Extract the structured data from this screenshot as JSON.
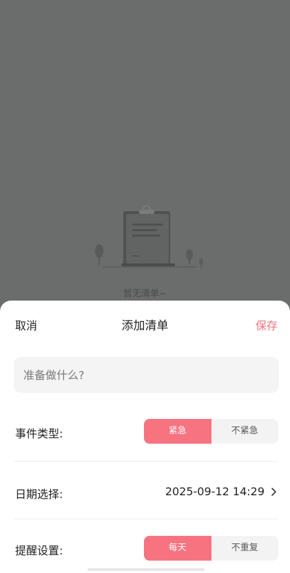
{
  "background": {
    "empty_text": "暂无清单~",
    "illustration_icon": "empty-clipboard-illustration"
  },
  "sheet": {
    "cancel_label": "取消",
    "title": "添加清单",
    "save_label": "保存",
    "input": {
      "placeholder": "准备做什么?",
      "value": ""
    },
    "event_type": {
      "label": "事件类型:",
      "options": [
        "紧急",
        "不紧急"
      ],
      "selected": "紧急"
    },
    "date": {
      "label": "日期选择:",
      "value": "2025-09-12 14:29",
      "icon": "chevron-right-icon"
    },
    "reminder": {
      "label": "提醒设置:",
      "options": [
        "每天",
        "不重复"
      ],
      "selected": "每天"
    }
  },
  "colors": {
    "accent": "#f77380",
    "save_text": "#f2737f",
    "overlay": "#6b6c6c"
  }
}
